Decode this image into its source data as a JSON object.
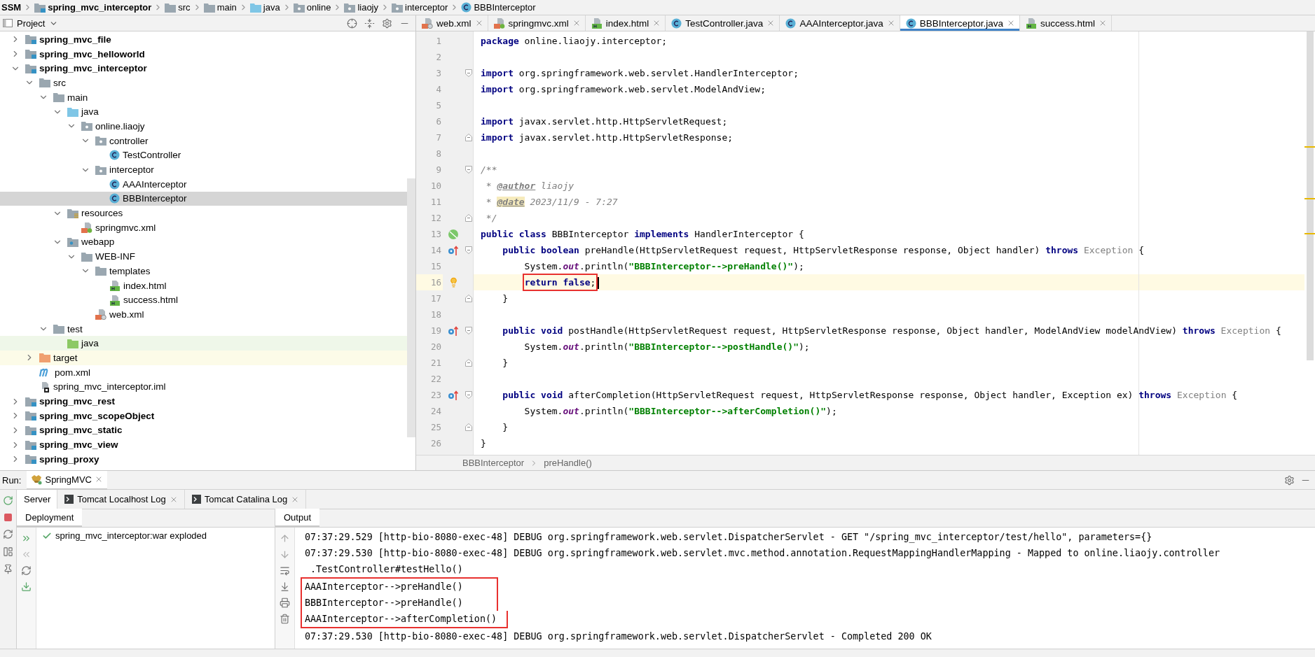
{
  "breadcrumbs": [
    {
      "label": "SSM",
      "kind": "root"
    },
    {
      "label": "spring_mvc_interceptor",
      "kind": "module"
    },
    {
      "label": "src",
      "kind": "folder"
    },
    {
      "label": "main",
      "kind": "folder"
    },
    {
      "label": "java",
      "kind": "source"
    },
    {
      "label": "online",
      "kind": "package"
    },
    {
      "label": "liaojy",
      "kind": "package"
    },
    {
      "label": "interceptor",
      "kind": "package"
    },
    {
      "label": "BBBInterceptor",
      "kind": "class"
    }
  ],
  "project": {
    "title": "Project",
    "tree": [
      {
        "label": "spring_mvc_file",
        "kind": "module",
        "expanded": false,
        "selected": false
      },
      {
        "label": "spring_mvc_helloworld",
        "kind": "module",
        "expanded": false,
        "selected": false
      },
      {
        "label": "spring_mvc_interceptor",
        "kind": "module",
        "expanded": true,
        "selected": false,
        "children": [
          {
            "label": "src",
            "kind": "folder",
            "expanded": true,
            "selected": false,
            "children": [
              {
                "label": "main",
                "kind": "folder",
                "expanded": true,
                "selected": false,
                "children": [
                  {
                    "label": "java",
                    "kind": "source",
                    "expanded": true,
                    "selected": false,
                    "children": [
                      {
                        "label": "online.liaojy",
                        "kind": "package",
                        "expanded": true,
                        "selected": false,
                        "children": [
                          {
                            "label": "controller",
                            "kind": "package",
                            "expanded": true,
                            "selected": false,
                            "children": [
                              {
                                "label": "TestController",
                                "kind": "class",
                                "selected": false
                              }
                            ]
                          },
                          {
                            "label": "interceptor",
                            "kind": "package",
                            "expanded": true,
                            "selected": false,
                            "children": [
                              {
                                "label": "AAAInterceptor",
                                "kind": "class",
                                "selected": false
                              },
                              {
                                "label": "BBBInterceptor",
                                "kind": "class",
                                "selected": true
                              }
                            ]
                          }
                        ]
                      }
                    ]
                  },
                  {
                    "label": "resources",
                    "kind": "resources",
                    "expanded": true,
                    "selected": false,
                    "children": [
                      {
                        "label": "springmvc.xml",
                        "kind": "spring-xml",
                        "selected": false
                      }
                    ]
                  },
                  {
                    "label": "webapp",
                    "kind": "webapp",
                    "expanded": true,
                    "selected": false,
                    "children": [
                      {
                        "label": "WEB-INF",
                        "kind": "folder",
                        "expanded": true,
                        "selected": false,
                        "children": [
                          {
                            "label": "templates",
                            "kind": "folder",
                            "expanded": true,
                            "selected": false,
                            "children": [
                              {
                                "label": "index.html",
                                "kind": "html",
                                "selected": false
                              },
                              {
                                "label": "success.html",
                                "kind": "html",
                                "selected": false
                              }
                            ]
                          },
                          {
                            "label": "web.xml",
                            "kind": "xml",
                            "selected": false
                          }
                        ]
                      }
                    ]
                  }
                ]
              },
              {
                "label": "test",
                "kind": "folder",
                "expanded": true,
                "selected": false,
                "children": [
                  {
                    "label": "java",
                    "kind": "test-source",
                    "selected": false
                  }
                ]
              }
            ]
          },
          {
            "label": "target",
            "kind": "excluded",
            "expanded": false,
            "selected": false
          },
          {
            "label": "pom.xml",
            "kind": "maven",
            "selected": false
          },
          {
            "label": "spring_mvc_interceptor.iml",
            "kind": "iml",
            "selected": false
          }
        ]
      },
      {
        "label": "spring_mvc_rest",
        "kind": "module",
        "expanded": false,
        "selected": false
      },
      {
        "label": "spring_mvc_scopeObject",
        "kind": "module",
        "expanded": false,
        "selected": false
      },
      {
        "label": "spring_mvc_static",
        "kind": "module",
        "expanded": false,
        "selected": false
      },
      {
        "label": "spring_mvc_view",
        "kind": "module",
        "expanded": false,
        "selected": false
      },
      {
        "label": "spring_proxy",
        "kind": "module",
        "expanded": false,
        "selected": false
      }
    ]
  },
  "editor": {
    "tabs": [
      {
        "label": "web.xml",
        "kind": "xml",
        "selected": false
      },
      {
        "label": "springmvc.xml",
        "kind": "spring-xml",
        "selected": false
      },
      {
        "label": "index.html",
        "kind": "html",
        "selected": false
      },
      {
        "label": "TestController.java",
        "kind": "class",
        "selected": false
      },
      {
        "label": "AAAInterceptor.java",
        "kind": "class",
        "selected": false
      },
      {
        "label": "BBBInterceptor.java",
        "kind": "class",
        "selected": true
      },
      {
        "label": "success.html",
        "kind": "html",
        "selected": false
      }
    ],
    "lines": [
      {
        "number": "1",
        "tokens": [
          {
            "text": "package",
            "kind": "keyword"
          },
          {
            "text": " online.liaojy.interceptor;",
            "kind": "plain"
          }
        ]
      },
      {
        "number": "2"
      },
      {
        "number": "3",
        "fold_start": true,
        "tokens": [
          {
            "text": "import",
            "kind": "keyword"
          },
          {
            "text": " org.springframework.web.servlet.HandlerInterceptor;",
            "kind": "plain"
          }
        ]
      },
      {
        "number": "4",
        "tokens": [
          {
            "text": "import",
            "kind": "keyword"
          },
          {
            "text": " org.springframework.web.servlet.ModelAndView;",
            "kind": "plain"
          }
        ]
      },
      {
        "number": "5"
      },
      {
        "number": "6",
        "tokens": [
          {
            "text": "import",
            "kind": "keyword"
          },
          {
            "text": " javax.servlet.http.HttpServletRequest;",
            "kind": "plain"
          }
        ]
      },
      {
        "number": "7",
        "fold_end": true,
        "tokens": [
          {
            "text": "import",
            "kind": "keyword"
          },
          {
            "text": " javax.servlet.http.HttpServletResponse;",
            "kind": "plain"
          }
        ]
      },
      {
        "number": "8"
      },
      {
        "number": "9",
        "fold_start": true,
        "tokens": [
          {
            "text": "/**",
            "kind": "doc"
          }
        ]
      },
      {
        "number": "10",
        "tokens": [
          {
            "text": " * ",
            "kind": "doc"
          },
          {
            "text": "@author",
            "kind": "tag"
          },
          {
            "text": " liaojy",
            "kind": "doc"
          }
        ]
      },
      {
        "number": "11",
        "tokens": [
          {
            "text": " * ",
            "kind": "doc"
          },
          {
            "text": "@date",
            "kind": "tag",
            "marked": true
          },
          {
            "text": " 2023/11/9 - 7:27",
            "kind": "doc"
          }
        ]
      },
      {
        "number": "12",
        "fold_end": true,
        "tokens": [
          {
            "text": " */",
            "kind": "doc"
          }
        ]
      },
      {
        "number": "13",
        "marker": {
          "kind": "implemented"
        },
        "tokens": [
          {
            "text": "public class",
            "kind": "keyword"
          },
          {
            "text": " BBBInterceptor ",
            "kind": "plain"
          },
          {
            "text": "implements",
            "kind": "keyword"
          },
          {
            "text": " HandlerInterceptor {",
            "kind": "plain"
          }
        ]
      },
      {
        "number": "14",
        "marker": {
          "kind": "override"
        },
        "fold_start": true,
        "tokens": [
          {
            "text": "    public boolean",
            "kind": "keyword"
          },
          {
            "text": " preHandle(HttpServletRequest request, HttpServletResponse response, Object handler) ",
            "kind": "plain"
          },
          {
            "text": "throws",
            "kind": "keyword"
          },
          {
            "text": " Exception",
            "kind": "unresolved"
          },
          {
            "text": " {",
            "kind": "plain"
          }
        ]
      },
      {
        "number": "15",
        "tokens": [
          {
            "text": "        System.",
            "kind": "plain"
          },
          {
            "text": "out",
            "kind": "static"
          },
          {
            "text": ".println(",
            "kind": "plain"
          },
          {
            "text": "\"BBBInterceptor-->preHandle()\"",
            "kind": "string"
          },
          {
            "text": ");",
            "kind": "plain"
          }
        ]
      },
      {
        "number": "16",
        "marker": {
          "kind": "bulb"
        },
        "current": true,
        "caret": true,
        "boxed": true,
        "tokens": [
          {
            "text": "        return false",
            "kind": "keyword"
          },
          {
            "text": ";",
            "kind": "plain"
          }
        ]
      },
      {
        "number": "17",
        "fold_end": true,
        "tokens": [
          {
            "text": "    }",
            "kind": "plain"
          }
        ]
      },
      {
        "number": "18"
      },
      {
        "number": "19",
        "marker": {
          "kind": "override"
        },
        "fold_start": true,
        "tokens": [
          {
            "text": "    public void",
            "kind": "keyword"
          },
          {
            "text": " postHandle(HttpServletRequest request, HttpServletResponse response, Object handler, ModelAndView modelAndView) ",
            "kind": "plain"
          },
          {
            "text": "throws",
            "kind": "keyword"
          },
          {
            "text": " Exception",
            "kind": "unresolved"
          },
          {
            "text": " {",
            "kind": "plain"
          }
        ]
      },
      {
        "number": "20",
        "tokens": [
          {
            "text": "        System.",
            "kind": "plain"
          },
          {
            "text": "out",
            "kind": "static"
          },
          {
            "text": ".println(",
            "kind": "plain"
          },
          {
            "text": "\"BBBInterceptor-->postHandle()\"",
            "kind": "string"
          },
          {
            "text": ");",
            "kind": "plain"
          }
        ]
      },
      {
        "number": "21",
        "fold_end": true,
        "tokens": [
          {
            "text": "    }",
            "kind": "plain"
          }
        ]
      },
      {
        "number": "22"
      },
      {
        "number": "23",
        "marker": {
          "kind": "override"
        },
        "fold_start": true,
        "tokens": [
          {
            "text": "    public void",
            "kind": "keyword"
          },
          {
            "text": " afterCompletion(HttpServletRequest request, HttpServletResponse response, Object handler, Exception ex) ",
            "kind": "plain"
          },
          {
            "text": "throws",
            "kind": "keyword"
          },
          {
            "text": " Exception",
            "kind": "unresolved"
          },
          {
            "text": " {",
            "kind": "plain"
          }
        ]
      },
      {
        "number": "24",
        "tokens": [
          {
            "text": "        System.",
            "kind": "plain"
          },
          {
            "text": "out",
            "kind": "static"
          },
          {
            "text": ".println(",
            "kind": "plain"
          },
          {
            "text": "\"BBBInterceptor-->afterCompletion()\"",
            "kind": "string"
          },
          {
            "text": ");",
            "kind": "plain"
          }
        ]
      },
      {
        "number": "25",
        "fold_end": true,
        "tokens": [
          {
            "text": "    }",
            "kind": "plain"
          }
        ]
      },
      {
        "number": "26",
        "tokens": [
          {
            "text": "}",
            "kind": "plain"
          }
        ]
      }
    ],
    "breadcrumb": [
      "BBBInterceptor",
      "preHandle()"
    ]
  },
  "run": {
    "label": "Run:",
    "config": "SpringMVC",
    "tabs": [
      {
        "label": "Server",
        "kind": "plain",
        "selected": true
      },
      {
        "label": "Tomcat Localhost Log",
        "kind": "log",
        "selected": false
      },
      {
        "label": "Tomcat Catalina Log",
        "kind": "log",
        "selected": false
      }
    ],
    "deployment": {
      "title": "Deployment",
      "items": [
        {
          "label": "spring_mvc_interceptor:war exploded",
          "deployed": true
        }
      ]
    },
    "output": {
      "title": "Output",
      "lines": [
        {
          "text": "07:37:29.529 [http-bio-8080-exec-48] DEBUG org.springframework.web.servlet.DispatcherServlet - GET \"/spring_mvc_interceptor/test/hello\", parameters={}",
          "boxed": false
        },
        {
          "text": "07:37:29.530 [http-bio-8080-exec-48] DEBUG org.springframework.web.servlet.mvc.method.annotation.RequestMappingHandlerMapping - Mapped to online.liaojy.controller",
          "boxed": false
        },
        {
          "text": " .TestController#testHello()",
          "boxed": false
        },
        {
          "text": "AAAInterceptor-->preHandle()",
          "boxed": true
        },
        {
          "text": "BBBInterceptor-->preHandle()",
          "boxed": true
        },
        {
          "text": "AAAInterceptor-->afterCompletion()",
          "boxed": true
        },
        {
          "text": "07:37:29.530 [http-bio-8080-exec-48] DEBUG org.springframework.web.servlet.DispatcherServlet - Completed 200 OK",
          "boxed": false
        }
      ]
    }
  }
}
